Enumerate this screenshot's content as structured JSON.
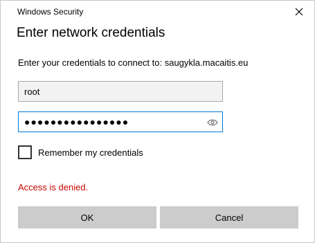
{
  "window": {
    "title": "Windows Security"
  },
  "dialog": {
    "heading": "Enter network credentials",
    "message": "Enter your credentials to connect to: saugykla.macaitis.eu"
  },
  "username": {
    "value": "root"
  },
  "password": {
    "masked_value": "●●●●●●●●●●●●●●●●",
    "reveal_icon": "eye-icon"
  },
  "remember": {
    "label": "Remember my credentials",
    "checked": false
  },
  "error": {
    "text": "Access is denied.",
    "color": "#c50500"
  },
  "buttons": {
    "ok_label": "OK",
    "cancel_label": "Cancel"
  },
  "colors": {
    "accent": "#0078d7",
    "button_bg": "#cccccc"
  }
}
